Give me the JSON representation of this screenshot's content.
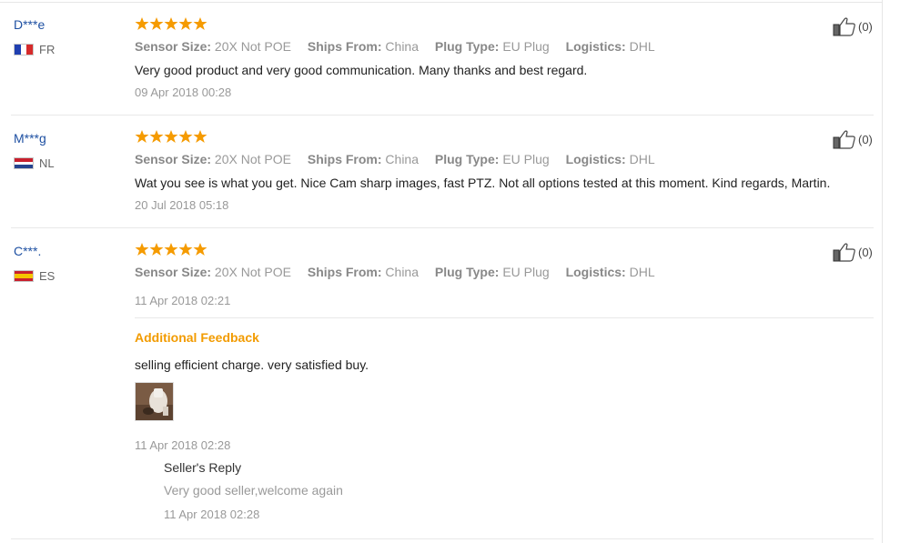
{
  "colors": {
    "star": "#f59b00",
    "username": "#1e50a2",
    "accent": "#f29b00",
    "muted": "#999999"
  },
  "reviews": [
    {
      "user": "D***e",
      "country": "FR",
      "flag": "flag-fr-icon",
      "rating_stars": 5,
      "attrs": {
        "sensor_label": "Sensor Size:",
        "sensor_value": "20X Not POE",
        "ships_label": "Ships From:",
        "ships_value": "China",
        "plug_label": "Plug Type:",
        "plug_value": "EU Plug",
        "logistics_label": "Logistics:",
        "logistics_value": "DHL"
      },
      "text": "Very good product and very good communication. Many thanks and best regard.",
      "date": "09 Apr 2018 00:28",
      "likes": "(0)"
    },
    {
      "user": "M***g",
      "country": "NL",
      "flag": "flag-nl-icon",
      "rating_stars": 5,
      "attrs": {
        "sensor_label": "Sensor Size:",
        "sensor_value": "20X Not POE",
        "ships_label": "Ships From:",
        "ships_value": "China",
        "plug_label": "Plug Type:",
        "plug_value": "EU Plug",
        "logistics_label": "Logistics:",
        "logistics_value": "DHL"
      },
      "text": "Wat you see is what you get. Nice Cam sharp images, fast PTZ. Not all options tested at this moment. Kind regards, Martin.",
      "date": "20 Jul 2018 05:18",
      "likes": "(0)"
    },
    {
      "user": "C***.",
      "country": "ES",
      "flag": "flag-es-icon",
      "rating_stars": 5,
      "attrs": {
        "sensor_label": "Sensor Size:",
        "sensor_value": "20X Not POE",
        "ships_label": "Ships From:",
        "ships_value": "China",
        "plug_label": "Plug Type:",
        "plug_value": "EU Plug",
        "logistics_label": "Logistics:",
        "logistics_value": "DHL"
      },
      "date": "11 Apr 2018 02:21",
      "likes": "(0)",
      "additional": {
        "title": "Additional Feedback",
        "text": "selling efficient charge. very satisfied buy.",
        "date": "11 Apr 2018 02:28",
        "reply": {
          "title": "Seller's Reply",
          "text": "Very good seller,welcome again",
          "date": "11 Apr 2018 02:28"
        }
      }
    }
  ]
}
